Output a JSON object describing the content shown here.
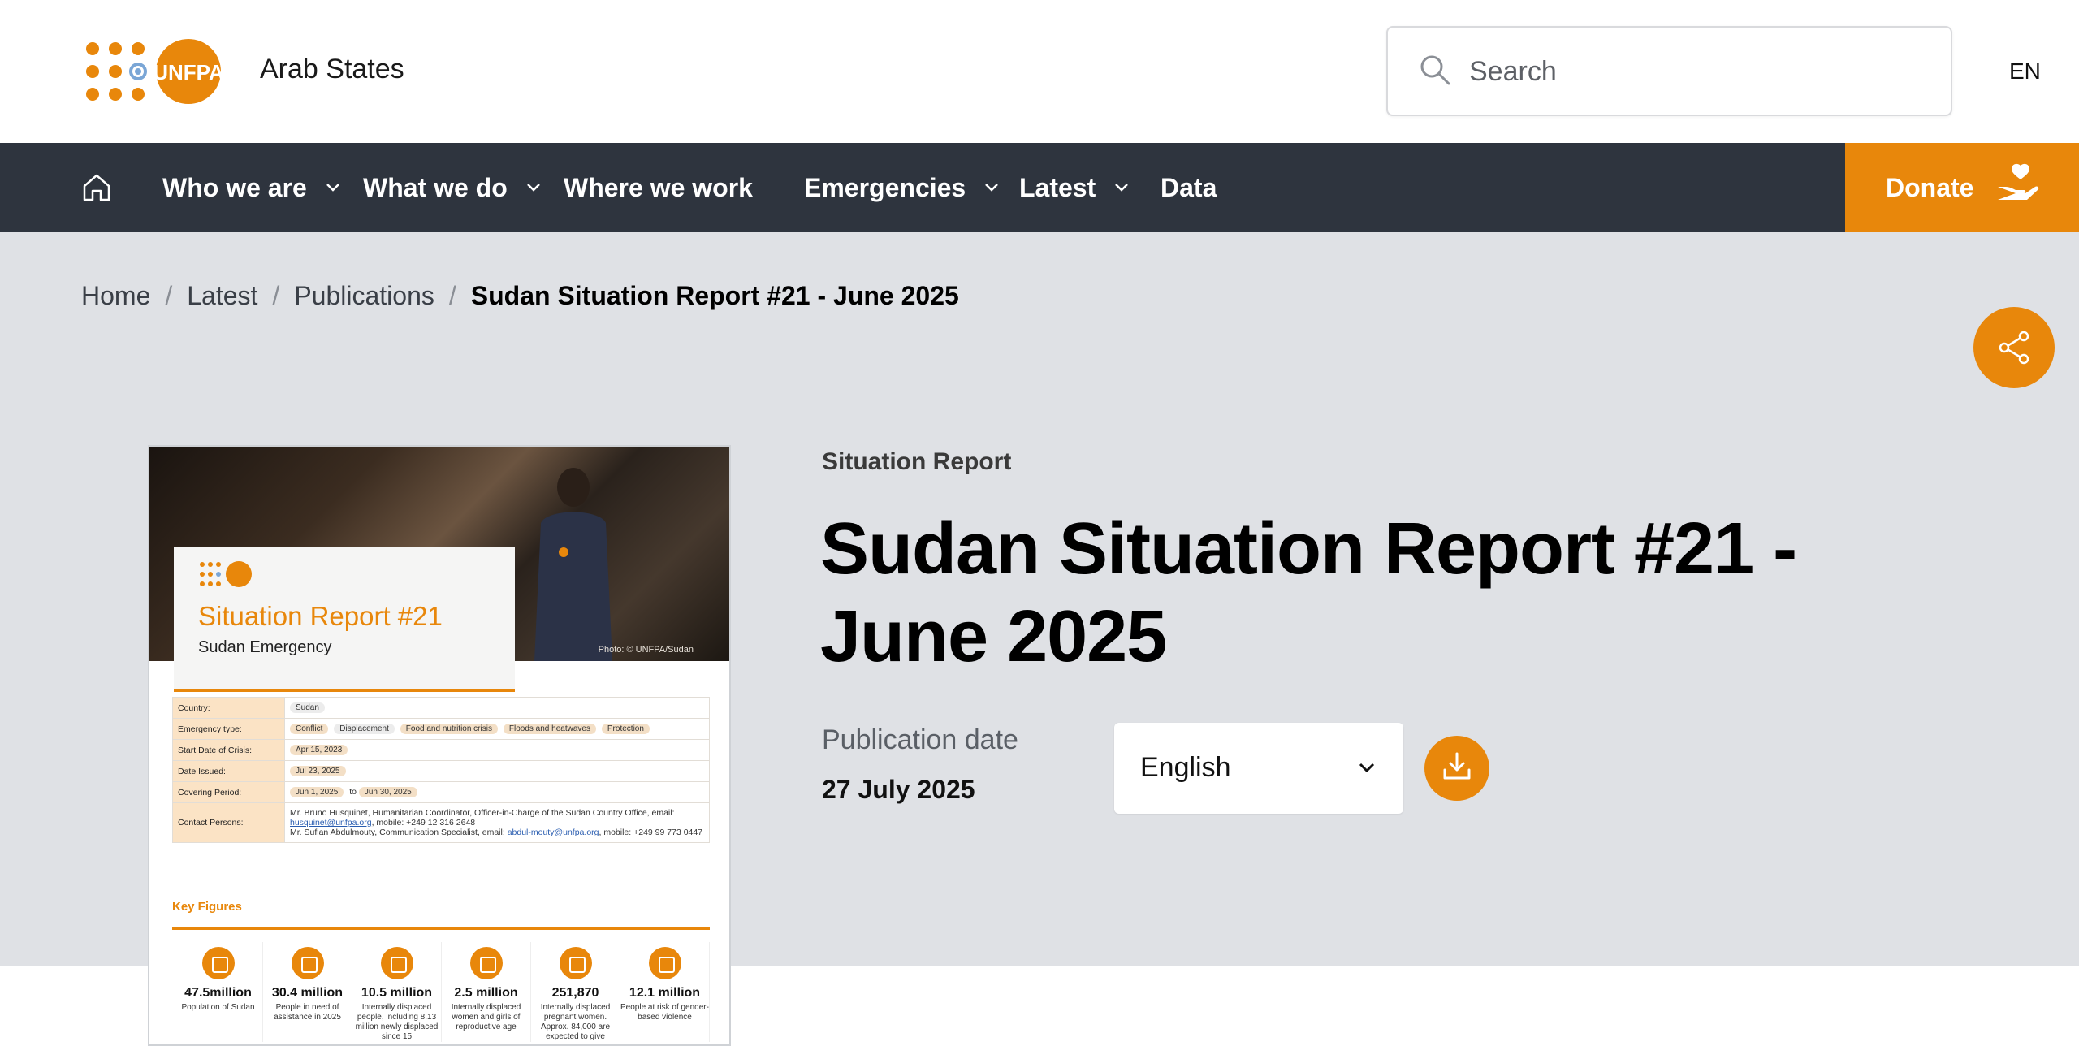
{
  "header": {
    "region": "Arab States",
    "search_placeholder": "Search",
    "language": "EN"
  },
  "nav": {
    "items": [
      {
        "label": "Who we are",
        "dropdown": true
      },
      {
        "label": "What we do",
        "dropdown": true
      },
      {
        "label": "Where we work",
        "dropdown": false
      },
      {
        "label": "Emergencies",
        "dropdown": true
      },
      {
        "label": "Latest",
        "dropdown": true
      },
      {
        "label": "Data",
        "dropdown": false
      }
    ],
    "donate": "Donate"
  },
  "breadcrumb": [
    "Home",
    "Latest",
    "Publications",
    "Sudan Situation Report #21 - June 2025"
  ],
  "publication": {
    "type": "Situation Report",
    "title": "Sudan Situation Report #21 - June 2025",
    "date_label": "Publication date",
    "date": "27 July 2025",
    "language": "English"
  },
  "cover": {
    "photo_credit": "Photo: © UNFPA/Sudan",
    "title": "Situation Report #21",
    "subtitle": "Sudan Emergency",
    "rows": [
      {
        "key": "Country:",
        "values": [
          "Sudan"
        ]
      },
      {
        "key": "Emergency type:",
        "values": [
          "Conflict",
          "Displacement",
          "Food and nutrition crisis",
          "Floods and heatwaves",
          "Protection"
        ]
      },
      {
        "key": "Start Date of Crisis:",
        "values": [
          "Apr 15, 2023"
        ]
      },
      {
        "key": "Date Issued:",
        "values": [
          "Jul 23, 2025"
        ]
      },
      {
        "key": "Covering Period:",
        "values": [
          "Jun 1, 2025",
          "to",
          "Jun 30, 2025"
        ]
      }
    ],
    "contact_key": "Contact Persons:",
    "contact_1": "Mr. Bruno Husquinet, Humanitarian Coordinator, Officer-in-Charge of the Sudan Country Office, email:",
    "contact_1_email": "husquinet@unfpa.org",
    "contact_1_tail": ", mobile: +249 12 316 2648",
    "contact_2": "Mr. Sufian Abdulmouty, Communication Specialist, email:",
    "contact_2_email": "abdul-mouty@unfpa.org",
    "contact_2_tail": ", mobile: +249 99 773 0447",
    "key_figures_title": "Key Figures",
    "key_figures": [
      {
        "num": "47.5million",
        "label": "Population of Sudan"
      },
      {
        "num": "30.4 million",
        "label": "People in need of assistance in 2025"
      },
      {
        "num": "10.5 million",
        "label": "Internally displaced people, including 8.13 million newly displaced since 15"
      },
      {
        "num": "2.5 million",
        "label": "Internally displaced women and girls of reproductive age"
      },
      {
        "num": "251,870",
        "label": "Internally displaced pregnant women. Approx. 84,000 are expected to give"
      },
      {
        "num": "12.1 million",
        "label": "People at risk of gender-based violence"
      }
    ]
  },
  "colors": {
    "brand_orange": "#e8870b",
    "nav_dark": "#2e343e",
    "hero_grey": "#dfe1e5"
  }
}
